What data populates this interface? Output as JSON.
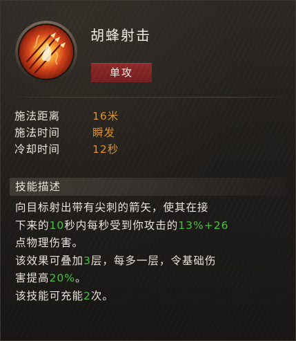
{
  "skill": {
    "name": "胡蜂射击",
    "tag": "单攻",
    "icon": "flaming-arrows-icon"
  },
  "stats": [
    {
      "label": "施法距离",
      "value": "16米"
    },
    {
      "label": "施法时间",
      "value": "瞬发"
    },
    {
      "label": "冷却时间",
      "value": "12秒"
    }
  ],
  "description": {
    "title": "技能描述",
    "lines": [
      {
        "t1": "向目标射出带有尖刺的箭矢，使其在接",
        "h1": "",
        "t2": "",
        "h2": "",
        "t3": ""
      },
      {
        "t1": "下来的",
        "h1": "10",
        "t2": "秒内每秒受到你攻击的",
        "h2": "13%+26",
        "t3": ""
      },
      {
        "t1": "点物理伤害。",
        "h1": "",
        "t2": "",
        "h2": "",
        "t3": ""
      },
      {
        "t1": "该效果可叠加",
        "h1": "3",
        "t2": "层，每多一层，令基础伤",
        "h2": "",
        "t3": ""
      },
      {
        "t1": "害提高",
        "h1": "20%",
        "t2": "。",
        "h2": "",
        "t3": ""
      },
      {
        "t1": "该技能可充能",
        "h1": "2",
        "t2": "次。",
        "h2": "",
        "t3": ""
      }
    ]
  },
  "colors": {
    "value_orange": "#e0922a",
    "highlight_green": "#4cc13d",
    "tag_red": "#8e2a2a",
    "text": "#ece6dc"
  }
}
